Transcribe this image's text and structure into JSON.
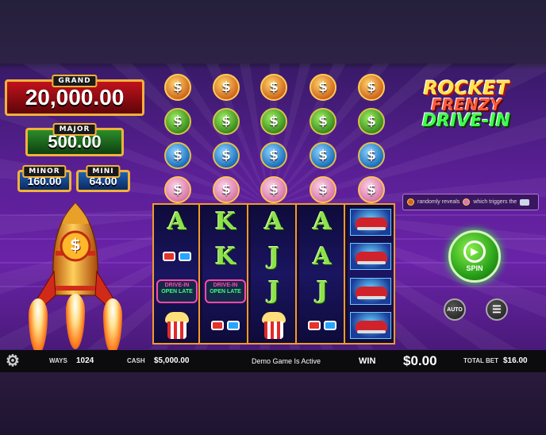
{
  "jackpots": {
    "grand": {
      "label": "GRAND",
      "value": "20,000.00"
    },
    "major": {
      "label": "MAJOR",
      "value": "500.00"
    },
    "minor": {
      "label": "MINOR",
      "value": "160.00"
    },
    "mini": {
      "label": "MINI",
      "value": "64.00"
    }
  },
  "coin_rows": [
    {
      "color": "gold",
      "symbol": "$"
    },
    {
      "color": "green",
      "symbol": "$"
    },
    {
      "color": "blue",
      "symbol": "$"
    },
    {
      "color": "pink",
      "symbol": "$"
    }
  ],
  "logo": {
    "line1": "ROCKET",
    "line2": "FRENZY",
    "line3": "DRIVE-IN"
  },
  "info_bar": {
    "part1": "randomly reveals",
    "part2": "which triggers the"
  },
  "reels": [
    [
      "A",
      "glasses",
      "sign",
      "popcorn"
    ],
    [
      "K",
      "K",
      "sign",
      "glasses"
    ],
    [
      "A",
      "J",
      "J",
      "popcorn"
    ],
    [
      "A",
      "A",
      "J",
      "glasses"
    ],
    [
      "car",
      "car",
      "car",
      "car"
    ]
  ],
  "sign": {
    "line1": "DRIVE-IN",
    "line2": "OPEN LATE"
  },
  "rocket": {
    "symbol": "$"
  },
  "controls": {
    "spin_label": "SPIN",
    "auto_label": "AUTO"
  },
  "bottom_bar": {
    "ways_label": "WAYS",
    "ways_value": "1024",
    "cash_label": "CASH",
    "cash_value": "$5,000.00",
    "status": "Demo Game Is Active",
    "win_label": "WIN",
    "win_value": "$0.00",
    "total_bet_label": "TOTAL BET",
    "total_bet_value": "$16.00"
  },
  "colors": {
    "reel_border": "#f29a2a",
    "spin_green": "#2aa31a",
    "background_purple": "#5a1f95"
  }
}
